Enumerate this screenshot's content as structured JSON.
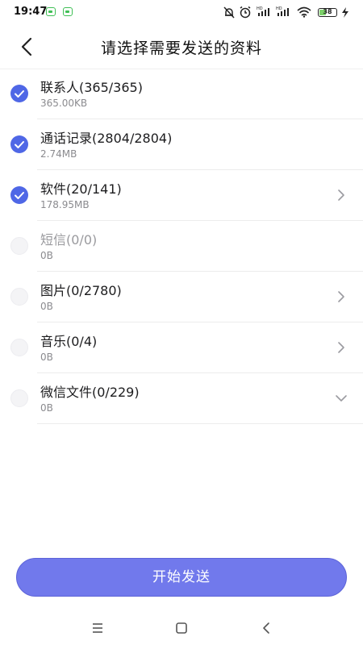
{
  "status_bar": {
    "time": "19:47",
    "battery": "38"
  },
  "header": {
    "title": "请选择需要发送的资料"
  },
  "items": [
    {
      "label": "联系人(365/365)",
      "size": "365.00KB",
      "checked": true,
      "disabled": false,
      "chevron": "none"
    },
    {
      "label": "通话记录(2804/2804)",
      "size": "2.74MB",
      "checked": true,
      "disabled": false,
      "chevron": "none"
    },
    {
      "label": "软件(20/141)",
      "size": "178.95MB",
      "checked": true,
      "disabled": false,
      "chevron": "right"
    },
    {
      "label": "短信(0/0)",
      "size": "0B",
      "checked": false,
      "disabled": true,
      "chevron": "none"
    },
    {
      "label": "图片(0/2780)",
      "size": "0B",
      "checked": false,
      "disabled": false,
      "chevron": "right"
    },
    {
      "label": "音乐(0/4)",
      "size": "0B",
      "checked": false,
      "disabled": false,
      "chevron": "right"
    },
    {
      "label": "微信文件(0/229)",
      "size": "0B",
      "checked": false,
      "disabled": false,
      "chevron": "down"
    }
  ],
  "footer": {
    "start_label": "开始发送"
  },
  "colors": {
    "accent": "#4f67e6",
    "button": "#7179ec"
  }
}
